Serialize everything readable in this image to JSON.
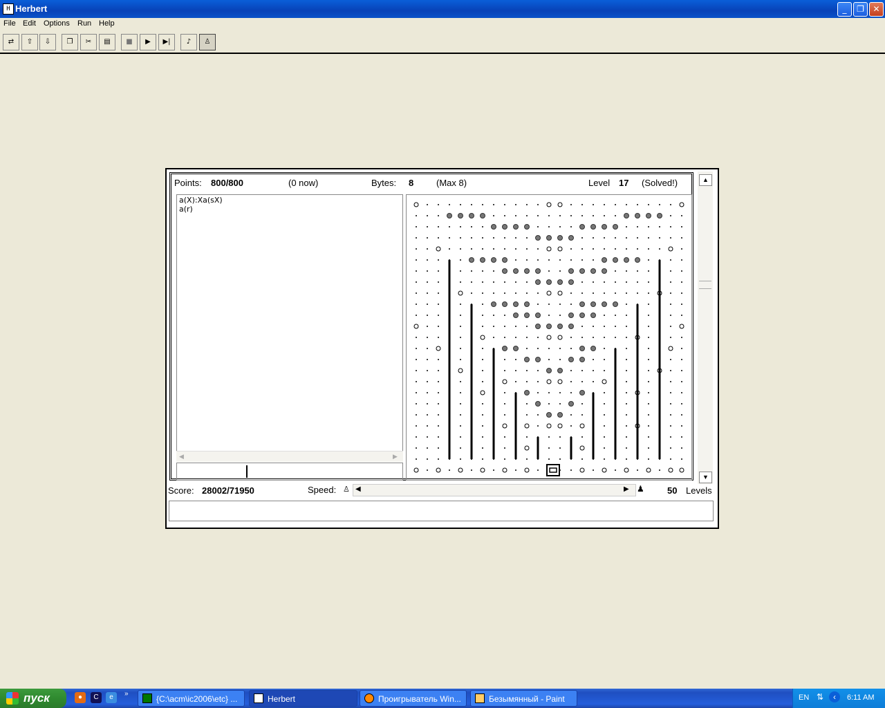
{
  "window": {
    "title": "Herbert",
    "app_icon": "herbert-icon"
  },
  "menu": [
    "File",
    "Edit",
    "Options",
    "Run",
    "Help"
  ],
  "toolbar": {
    "buttons": [
      {
        "name": "open-button",
        "glyph": "⇄"
      },
      {
        "name": "upload-button",
        "glyph": "⇧"
      },
      {
        "name": "download-button",
        "glyph": "⇩"
      },
      {
        "name": "copy-button",
        "glyph": "❐"
      },
      {
        "name": "cut-button",
        "glyph": "✂"
      },
      {
        "name": "paste-button",
        "glyph": "▤"
      },
      {
        "name": "stop-button",
        "glyph": "■"
      },
      {
        "name": "run-button",
        "glyph": "▶"
      },
      {
        "name": "step-button",
        "glyph": "▶|"
      },
      {
        "name": "sound-button",
        "glyph": "♪"
      },
      {
        "name": "herbert-view-button",
        "glyph": "♙"
      }
    ]
  },
  "stats": {
    "points_label": "Points:",
    "points_value": "800/800",
    "now": "(0 now)",
    "bytes_label": "Bytes:",
    "bytes_value": "8",
    "max": "(Max 8)",
    "level_label": "Level",
    "level_value": "17",
    "solved": "(Solved!)"
  },
  "code": [
    "a(X):Xa(sX)",
    "a(r)"
  ],
  "bottom": {
    "score_label": "Score:",
    "score_value": "28002/71950",
    "speed_label": "Speed:",
    "levels_count": "50",
    "levels_label": "Levels"
  },
  "taskbar": {
    "start": "пуск",
    "quick_launch": [
      "firefox-icon",
      "terminal-icon",
      "browser-icon"
    ],
    "tasks": [
      {
        "label": "{C:\\acm\\ic2006\\etc} ...",
        "active": false
      },
      {
        "label": "Herbert",
        "active": true
      },
      {
        "label": "Проигрыватель Win...",
        "active": false
      },
      {
        "label": "Безымянный - Paint",
        "active": false
      }
    ],
    "lang": "EN",
    "time": "6:11 AM"
  },
  "colors": {
    "titlebar": "#0a5fd8",
    "taskbar": "#245edb",
    "start": "#2f8a2f",
    "window_bg": "#ece9d8"
  }
}
